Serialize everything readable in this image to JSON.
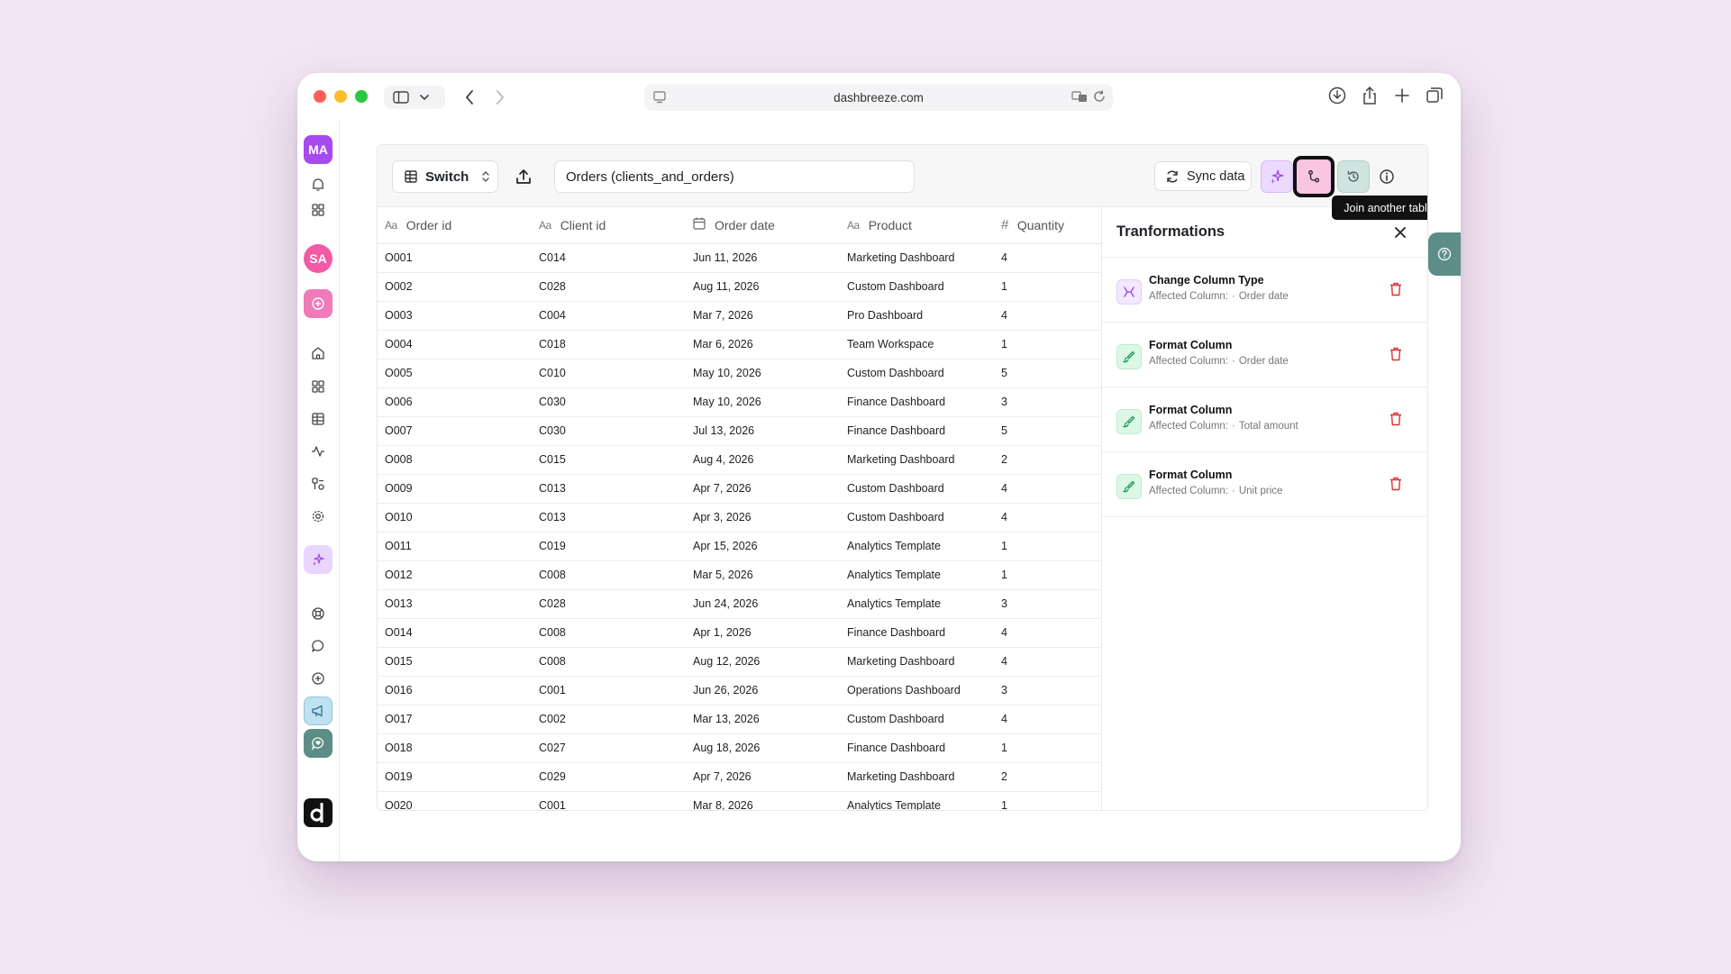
{
  "browser": {
    "url": "dashbreeze.com"
  },
  "sidebar": {
    "user_initials": "MA",
    "workspace_initials": "SA",
    "colors": {
      "user": "#a64af0",
      "workspace": "#f25aa4",
      "add": "#f07bb8",
      "ai": "#e9d5ff",
      "announce": "#bfe1f0",
      "heart": "#5c8d86"
    }
  },
  "toolbar": {
    "switch_label": "Switch",
    "table_name": "Orders (clients_and_orders)",
    "sync_label": "Sync data",
    "tooltip": "Join another table"
  },
  "table": {
    "columns": [
      {
        "type_icon": "Aa",
        "label": "Order id"
      },
      {
        "type_icon": "Aa",
        "label": "Client id"
      },
      {
        "type_icon": "calendar-icon",
        "label": "Order date"
      },
      {
        "type_icon": "Aa",
        "label": "Product"
      },
      {
        "type_icon": "#",
        "label": "Quantity"
      }
    ],
    "rows": [
      [
        "O001",
        "C014",
        "Jun 11, 2026",
        "Marketing Dashboard",
        "4"
      ],
      [
        "O002",
        "C028",
        "Aug 11, 2026",
        "Custom Dashboard",
        "1"
      ],
      [
        "O003",
        "C004",
        "Mar 7, 2026",
        "Pro Dashboard",
        "4"
      ],
      [
        "O004",
        "C018",
        "Mar 6, 2026",
        "Team Workspace",
        "1"
      ],
      [
        "O005",
        "C010",
        "May 10, 2026",
        "Custom Dashboard",
        "5"
      ],
      [
        "O006",
        "C030",
        "May 10, 2026",
        "Finance Dashboard",
        "3"
      ],
      [
        "O007",
        "C030",
        "Jul 13, 2026",
        "Finance Dashboard",
        "5"
      ],
      [
        "O008",
        "C015",
        "Aug 4, 2026",
        "Marketing Dashboard",
        "2"
      ],
      [
        "O009",
        "C013",
        "Apr 7, 2026",
        "Custom Dashboard",
        "4"
      ],
      [
        "O010",
        "C013",
        "Apr 3, 2026",
        "Custom Dashboard",
        "4"
      ],
      [
        "O011",
        "C019",
        "Apr 15, 2026",
        "Analytics Template",
        "1"
      ],
      [
        "O012",
        "C008",
        "Mar 5, 2026",
        "Analytics Template",
        "1"
      ],
      [
        "O013",
        "C028",
        "Jun 24, 2026",
        "Analytics Template",
        "3"
      ],
      [
        "O014",
        "C008",
        "Apr 1, 2026",
        "Finance Dashboard",
        "4"
      ],
      [
        "O015",
        "C008",
        "Aug 12, 2026",
        "Marketing Dashboard",
        "4"
      ],
      [
        "O016",
        "C001",
        "Jun 26, 2026",
        "Operations Dashboard",
        "3"
      ],
      [
        "O017",
        "C002",
        "Mar 13, 2026",
        "Custom Dashboard",
        "4"
      ],
      [
        "O018",
        "C027",
        "Aug 18, 2026",
        "Finance Dashboard",
        "1"
      ],
      [
        "O019",
        "C029",
        "Apr 7, 2026",
        "Marketing Dashboard",
        "2"
      ],
      [
        "O020",
        "C001",
        "Mar 8, 2026",
        "Analytics Template",
        "1"
      ]
    ]
  },
  "transformations": {
    "title": "Tranformations",
    "items": [
      {
        "title": "Change Column Type",
        "affected_label": "Affected Column:",
        "column": "Order date",
        "icon": "change-type-icon",
        "color": "purple"
      },
      {
        "title": "Format Column",
        "affected_label": "Affected Column:",
        "column": "Order date",
        "icon": "brush-icon",
        "color": "green"
      },
      {
        "title": "Format Column",
        "affected_label": "Affected Column:",
        "column": "Total amount",
        "icon": "brush-icon",
        "color": "green"
      },
      {
        "title": "Format Column",
        "affected_label": "Affected Column:",
        "column": "Unit price",
        "icon": "brush-icon",
        "color": "green"
      }
    ]
  }
}
